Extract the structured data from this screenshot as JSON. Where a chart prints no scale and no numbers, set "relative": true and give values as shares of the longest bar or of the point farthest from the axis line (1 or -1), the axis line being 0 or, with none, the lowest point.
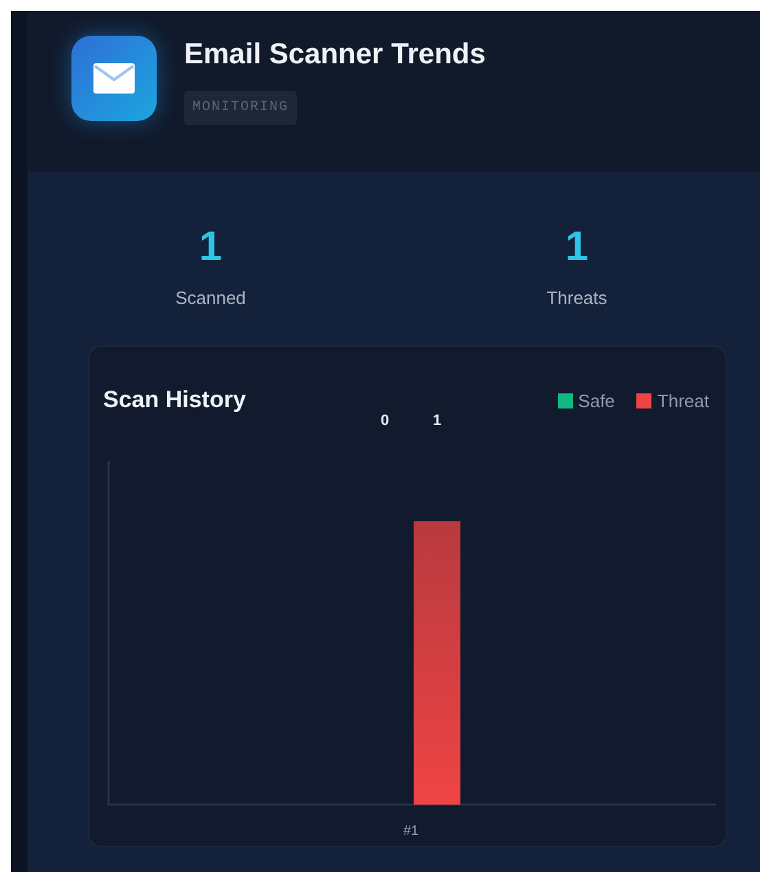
{
  "header": {
    "title": "Email Scanner Trends",
    "badge": "MONITORING"
  },
  "stats": [
    {
      "value": "1",
      "label": "Scanned"
    },
    {
      "value": "1",
      "label": "Threats"
    }
  ],
  "chart": {
    "title": "Scan History",
    "chart_data": {
      "type": "bar",
      "categories": [
        "#1"
      ],
      "series": [
        {
          "name": "Safe",
          "color": "#10b981",
          "values": [
            0
          ]
        },
        {
          "name": "Threat",
          "color": "#ef4444",
          "values": [
            1
          ]
        }
      ],
      "relative": true
    },
    "series_labels": [
      "0",
      "1"
    ]
  }
}
